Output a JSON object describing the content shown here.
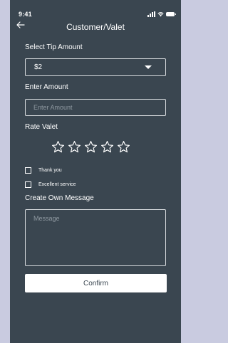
{
  "status_bar": {
    "time": "9:41"
  },
  "header": {
    "title": "Customer/Valet"
  },
  "tip": {
    "label": "Select Tip Amount",
    "selected": "$2"
  },
  "amount": {
    "label": "Enter Amount",
    "placeholder": "Enter Amount",
    "value": ""
  },
  "rating": {
    "label": "Rate Valet",
    "max_stars": 5,
    "value": 0
  },
  "options": [
    {
      "label": "Thank you",
      "checked": false
    },
    {
      "label": "Excellent service",
      "checked": false
    }
  ],
  "message": {
    "label": "Create Own Message",
    "placeholder": "Message",
    "value": ""
  },
  "confirm_label": "Confirm",
  "colors": {
    "screen_bg": "#3a4650",
    "page_bg": "#c9cbe0",
    "text": "#ffffff",
    "button_bg": "#ffffff"
  }
}
